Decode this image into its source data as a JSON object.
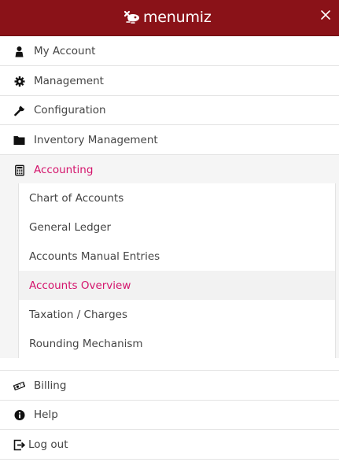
{
  "header": {
    "brand": "menumiz",
    "close_icon": "close-icon",
    "background_color": "#8a1218"
  },
  "menu": {
    "items": [
      {
        "label": "My Account",
        "icon": "user-icon"
      },
      {
        "label": "Management",
        "icon": "gear-icon"
      },
      {
        "label": "Configuration",
        "icon": "wrench-icon"
      },
      {
        "label": "Inventory Management",
        "icon": "folder-icon"
      },
      {
        "label": "Accounting",
        "icon": "calculator-icon",
        "active": true
      }
    ],
    "accounting_submenu": [
      {
        "label": "Chart of Accounts"
      },
      {
        "label": "General Ledger"
      },
      {
        "label": "Accounts Manual Entries"
      },
      {
        "label": "Accounts Overview",
        "active": true
      },
      {
        "label": "Taxation / Charges"
      },
      {
        "label": "Rounding Mechanism"
      }
    ],
    "bottom_items": [
      {
        "label": "Billing",
        "icon": "ticket-icon"
      },
      {
        "label": "Help",
        "icon": "info-icon"
      },
      {
        "label": "Log out",
        "icon": "logout-icon"
      }
    ]
  },
  "colors": {
    "accent": "#d4146c",
    "header": "#8a1218"
  }
}
